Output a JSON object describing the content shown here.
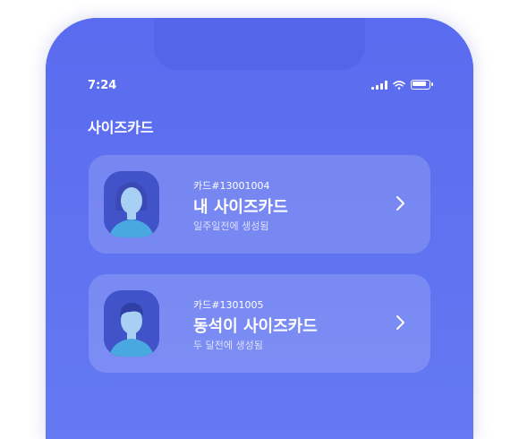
{
  "status": {
    "time": "7:24"
  },
  "page": {
    "title": "사이즈카드"
  },
  "cards": [
    {
      "number": "카드#13001004",
      "name": "내 사이즈카드",
      "sub": "일주일전에 생성됨",
      "avatar": "female-avatar"
    },
    {
      "number": "카드#1301005",
      "name": "동석이 사이즈카드",
      "sub": "두 달전에 생성됨",
      "avatar": "male-avatar"
    }
  ],
  "colors": {
    "background": "#5b6ef0",
    "avatar_bg": "#4153c9",
    "shirt": "#4aa8e0",
    "skin": "#a8d0f5"
  }
}
